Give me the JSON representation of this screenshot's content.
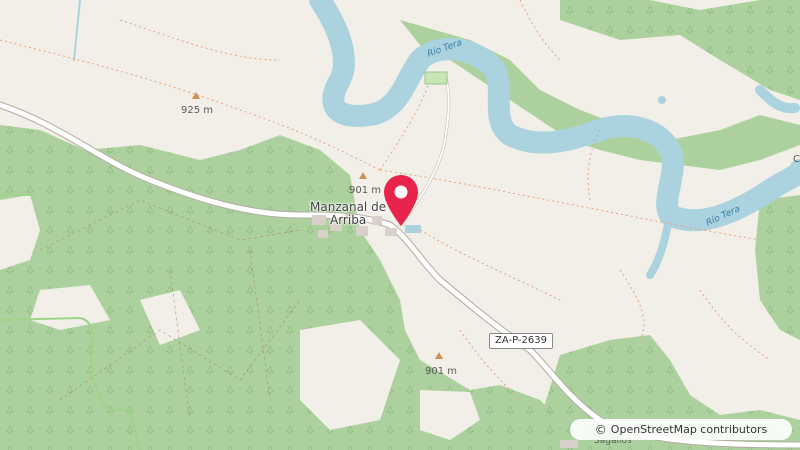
{
  "map": {
    "peaks": [
      {
        "id": "peak-925",
        "label": "925 m"
      },
      {
        "id": "peak-901-north",
        "label": "901 m"
      },
      {
        "id": "peak-901-south",
        "label": "901 m"
      }
    ],
    "town": {
      "line1": "Manzanal de",
      "line2": "Arriba"
    },
    "village_south": "Sagallos",
    "edge_label": "C",
    "rivers": [
      {
        "id": "river-label-north",
        "label": "Río Tera"
      },
      {
        "id": "river-label-east",
        "label": "Río Tera"
      }
    ],
    "road": {
      "ref": "ZA-P-2639"
    },
    "attribution": {
      "symbol": "©",
      "text": "OpenStreetMap contributors"
    },
    "marker": {
      "color": "#e8234c",
      "icon": "location-pin-icon"
    },
    "colors": {
      "land": "#f2efe9",
      "forest": "#add19e",
      "water": "#aad3df",
      "road": "#ffffff",
      "trail": "#e6a27a",
      "peak": "#d08f55"
    }
  }
}
